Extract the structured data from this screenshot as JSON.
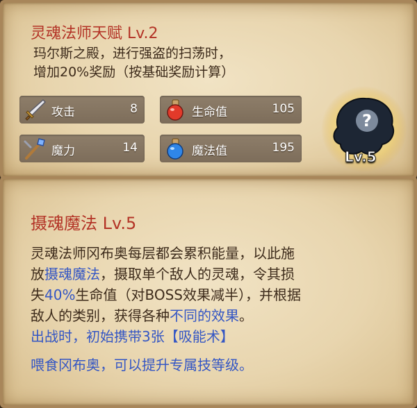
{
  "talent": {
    "title": "灵魂法师天赋 Lv.2",
    "desc_line1": "玛尔斯之殿，进行强盗的扫荡时，",
    "desc_line2": "增加20%奖励（按基础奖励计算）"
  },
  "stats": [
    {
      "label": "攻击",
      "value": "8",
      "icon": "sword-icon"
    },
    {
      "label": "生命值",
      "value": "105",
      "icon": "red-potion-icon"
    },
    {
      "label": "魔力",
      "value": "14",
      "icon": "staff-icon"
    },
    {
      "label": "魔法值",
      "value": "195",
      "icon": "blue-potion-icon"
    }
  ],
  "portrait": {
    "level": "Lv.5",
    "icon": "unknown-hero-icon"
  },
  "skill": {
    "title": "摄魂魔法 Lv.5",
    "l1": "灵魂法师冈布奥每层都会累积能量，以此施",
    "l2a": "放",
    "l2b": "摄魂魔法",
    "l2c": "，摄取单个敌人的灵魂，令其损",
    "l3a": "失",
    "l3b": "40%",
    "l3c": "生命值（对BOSS效果减半），并根据",
    "l4a": "敌人的类别，获得各种",
    "l4b": "不同的效果",
    "l4c": "。",
    "l5": "出战时，初始携带3张【吸能术】",
    "feed": "喂食冈布奥，可以提升专属技等级。"
  },
  "colors": {
    "title_red": "#b33326",
    "highlight_blue": "#3456c4",
    "text_brown": "#3d2b1b"
  }
}
